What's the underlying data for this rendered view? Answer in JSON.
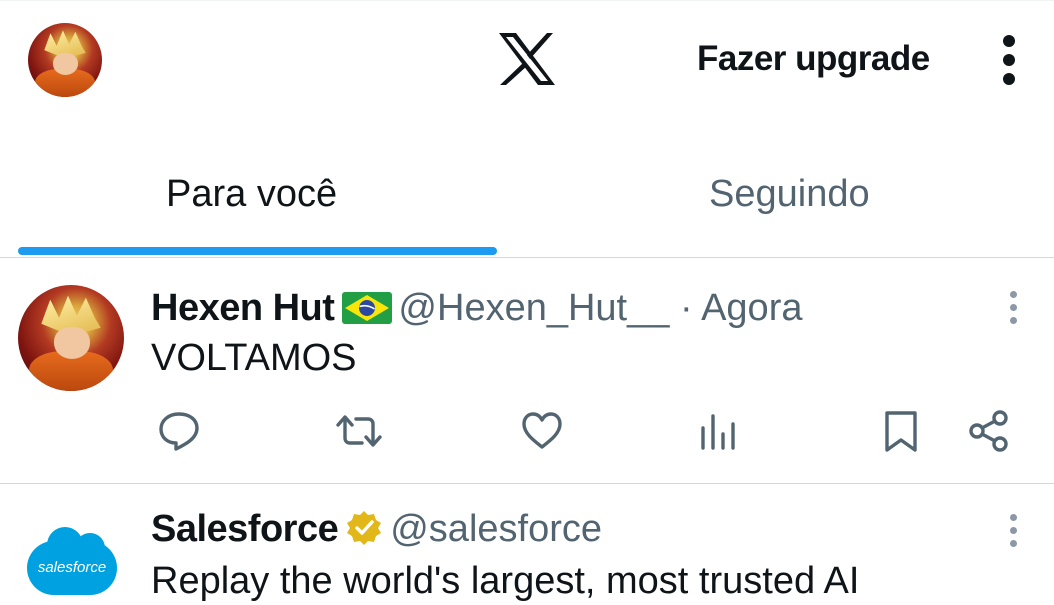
{
  "header": {
    "avatar": "user-avatar",
    "logo": "x-logo-icon",
    "upgrade_label": "Fazer upgrade",
    "menu_icon": "more-vertical-icon"
  },
  "tabs": [
    {
      "label": "Para você",
      "active": true
    },
    {
      "label": "Seguindo",
      "active": false
    }
  ],
  "colors": {
    "accent": "#1d9bf0",
    "text_primary": "#0f1419",
    "text_secondary": "#536471",
    "divider": "#cfd9de",
    "salesforce_blue": "#00a1e0",
    "verified_gold": "#e2b719"
  },
  "tweets": [
    {
      "name": "Hexen Hut",
      "flag": "brazil-flag-icon",
      "handle": "@Hexen_Hut__",
      "separator": "·",
      "time": "Agora",
      "text": "VOLTAMOS",
      "actions": [
        "reply-icon",
        "retweet-icon",
        "like-icon",
        "views-icon",
        "bookmark-icon",
        "share-icon"
      ]
    },
    {
      "name": "Salesforce",
      "verified": "verified-gold-badge-icon",
      "handle": "@salesforce",
      "avatar_text": "salesforce",
      "text": "Replay the world's largest, most trusted AI"
    }
  ]
}
